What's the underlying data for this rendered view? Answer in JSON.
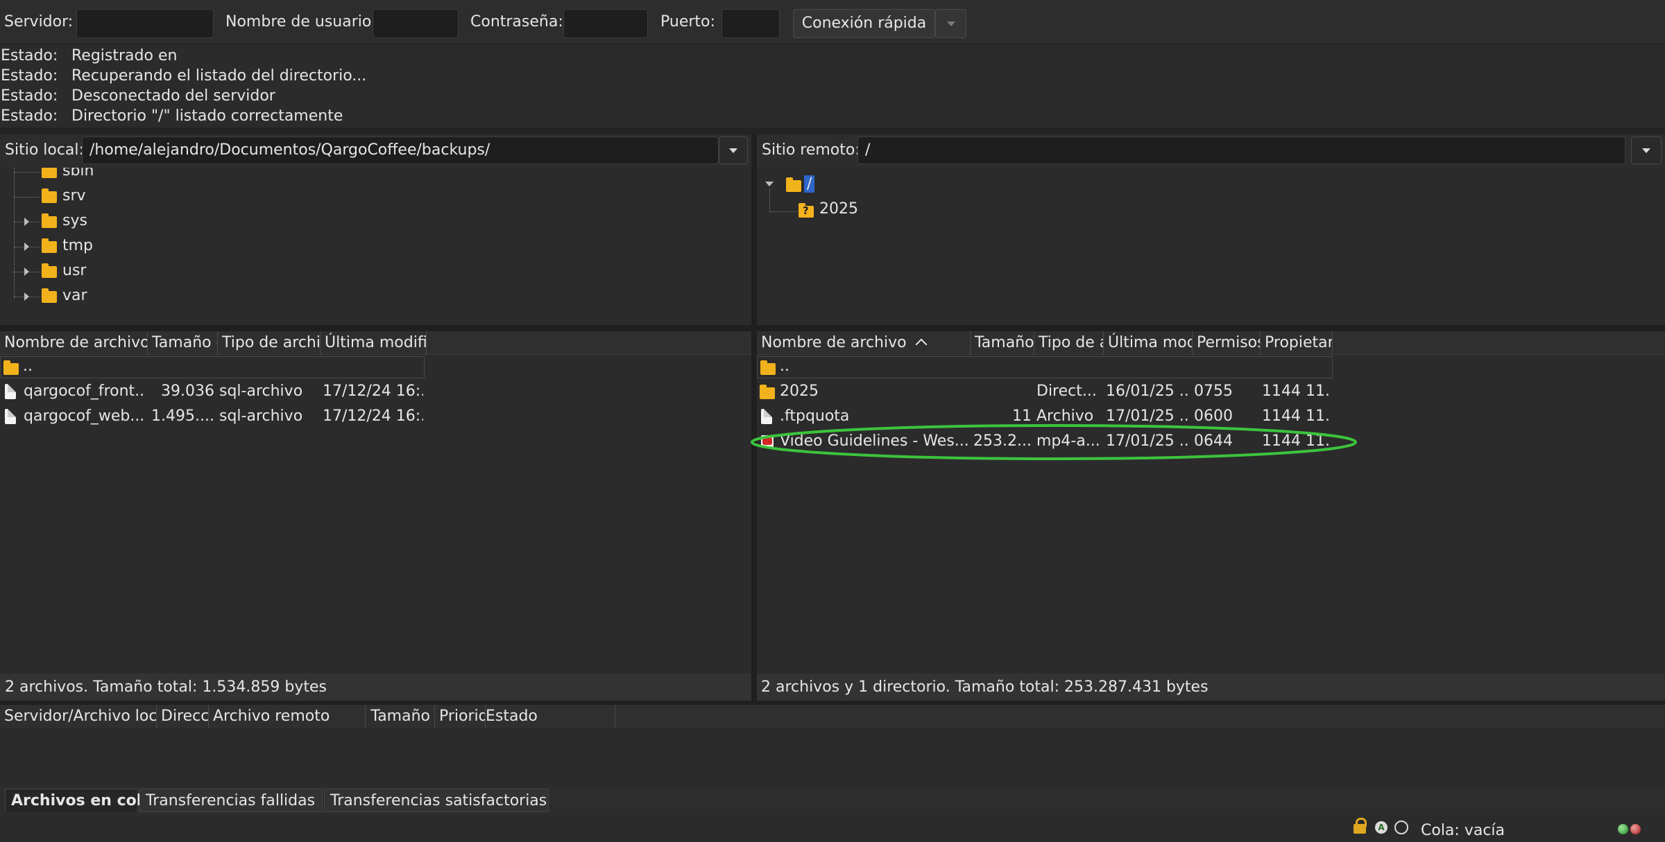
{
  "quickconnect": {
    "server_label": "Servidor:",
    "server_value": "",
    "user_label": "Nombre de usuario:",
    "user_value": "",
    "password_label": "Contraseña:",
    "password_value": "",
    "port_label": "Puerto:",
    "port_value": "",
    "connect_button": "Conexión rápida"
  },
  "log": [
    {
      "key": "Estado:",
      "msg": "Registrado en"
    },
    {
      "key": "Estado:",
      "msg": "Recuperando el listado del directorio..."
    },
    {
      "key": "Estado:",
      "msg": "Desconectado del servidor"
    },
    {
      "key": "Estado:",
      "msg": "Directorio \"/\" listado correctamente"
    }
  ],
  "local": {
    "site_label": "Sitio local:",
    "path": "/home/alejandro/Documentos/QargoCoffee/backups/",
    "tree": [
      {
        "name": "sbin",
        "expandable": false
      },
      {
        "name": "srv",
        "expandable": false
      },
      {
        "name": "sys",
        "expandable": true
      },
      {
        "name": "tmp",
        "expandable": true
      },
      {
        "name": "usr",
        "expandable": true
      },
      {
        "name": "var",
        "expandable": true
      }
    ],
    "columns": [
      "Nombre de archivo",
      "Tamaño d",
      "Tipo de archivo",
      "Última modific"
    ],
    "parent_row": "..",
    "files": [
      {
        "name": "qargocof_front...",
        "size": "39.036",
        "type": "sql-archivo",
        "modified": "17/12/24 16:..."
      },
      {
        "name": "qargocof_web...",
        "size": "1.495....",
        "type": "sql-archivo",
        "modified": "17/12/24 16:..."
      }
    ],
    "status": "2 archivos. Tamaño total: 1.534.859 bytes"
  },
  "remote": {
    "site_label": "Sitio remoto:",
    "path": "/",
    "tree_root": "/",
    "tree_child": "2025",
    "columns": [
      "Nombre de archivo",
      "Tamaño",
      "Tipo de a",
      "Última mod",
      "Permisos",
      "Propietari"
    ],
    "parent_row": "..",
    "files": [
      {
        "name": "2025",
        "size": "",
        "type": "Direct...",
        "modified": "16/01/25 ...",
        "perms": "0755",
        "owner": "1144 11...",
        "icon": "folder-icon"
      },
      {
        "name": ".ftpquota",
        "size": "11",
        "type": "Archivo",
        "modified": "17/01/25 ...",
        "perms": "0600",
        "owner": "1144 11...",
        "icon": "file-icon"
      },
      {
        "name": "Video Guidelines -  Wes...",
        "size": "253.2...",
        "type": "mp4-a...",
        "modified": "17/01/25 ...",
        "perms": "0644",
        "owner": "1144 11...",
        "icon": "video-icon"
      }
    ],
    "status": "2 archivos y 1 directorio. Tamaño total: 253.287.431 bytes",
    "highlight_color": "#3cc43c"
  },
  "queue": {
    "columns": [
      "Servidor/Archivo loca",
      "Direcc",
      "Archivo remoto",
      "Tamaño",
      "Priorid",
      "Estado"
    ],
    "tabs": [
      "Archivos en cola",
      "Transferencias fallidas",
      "Transferencias satisfactorias"
    ],
    "status": "Cola: vacía"
  }
}
